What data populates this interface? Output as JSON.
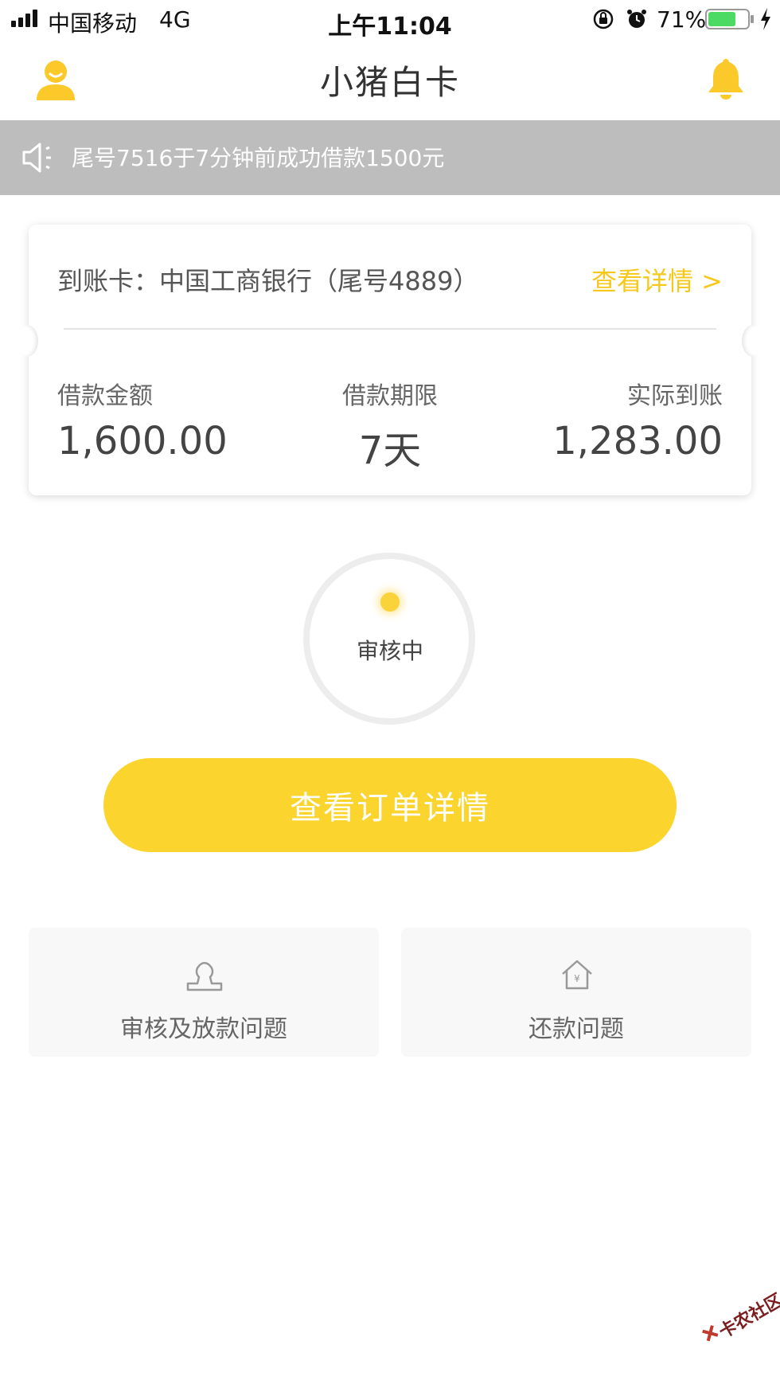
{
  "status_bar": {
    "carrier": "中国移动",
    "network": "4G",
    "time": "上午11:04",
    "battery": "71%",
    "battery_level": 0.71
  },
  "header": {
    "title": "小猪白卡"
  },
  "ticker": {
    "text": "尾号7516于7分钟前成功借款1500元"
  },
  "card": {
    "account_label": "到账卡：中国工商银行（尾号4889）",
    "details_link": "查看详情 >",
    "loan_amount_label": "借款金额",
    "loan_amount_value": "1,600.00",
    "term_label": "借款期限",
    "term_value": "7天",
    "received_label": "实际到账",
    "received_value": "1,283.00"
  },
  "review": {
    "status": "审核中"
  },
  "actions": {
    "order_details": "查看订单详情"
  },
  "help": {
    "review_loan": "审核及放款问题",
    "repayment": "还款问题"
  },
  "watermark": {
    "text": "卡农社区"
  },
  "colors": {
    "accent": "#fbd42e",
    "link": "#f7c81c",
    "ticker_bg": "#bdbdbd"
  }
}
